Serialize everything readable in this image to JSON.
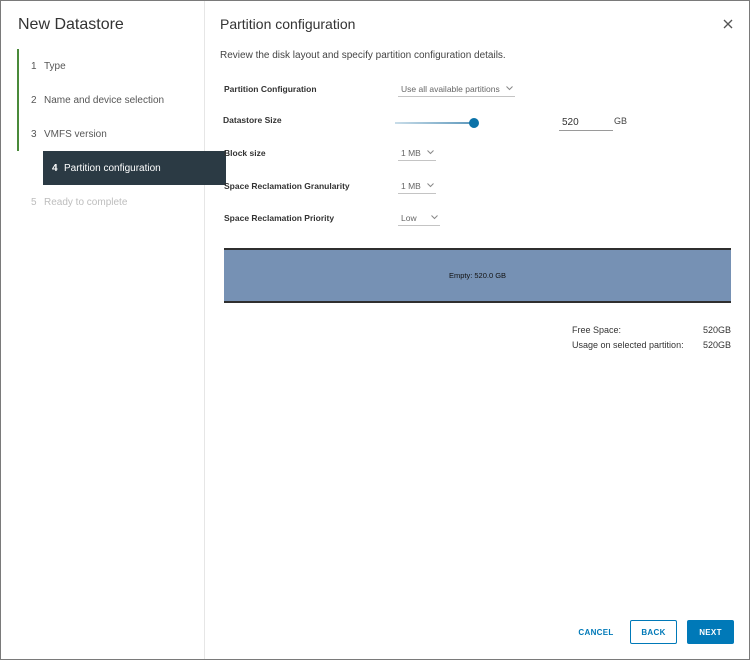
{
  "sidebar": {
    "title": "New Datastore",
    "steps": [
      {
        "num": "1",
        "label": "Type"
      },
      {
        "num": "2",
        "label": "Name and device selection"
      },
      {
        "num": "3",
        "label": "VMFS version"
      },
      {
        "num": "4",
        "label": "Partition configuration"
      },
      {
        "num": "5",
        "label": "Ready to complete"
      }
    ]
  },
  "main": {
    "title": "Partition configuration",
    "subtitle": "Review the disk layout and specify partition configuration details."
  },
  "form": {
    "partition_config_label": "Partition Configuration",
    "partition_config_value": "Use all available partitions",
    "datastore_size_label": "Datastore Size",
    "datastore_size_value": "520",
    "datastore_size_unit": "GB",
    "datastore_size_slider_fraction": 1.0,
    "block_size_label": "Block size",
    "block_size_value": "1 MB",
    "granularity_label": "Space Reclamation Granularity",
    "granularity_value": "1 MB",
    "priority_label": "Space Reclamation Priority",
    "priority_value": "Low"
  },
  "disk": {
    "label": "Empty: 520.0 GB",
    "color": "#7691b4"
  },
  "summary": {
    "free_space_label": "Free Space:",
    "free_space_value": "520GB",
    "usage_label": "Usage on selected partition:",
    "usage_value": "520GB"
  },
  "buttons": {
    "cancel": "CANCEL",
    "back": "BACK",
    "next": "NEXT"
  },
  "colors": {
    "accent": "#0079b8",
    "completed_step": "#4a8a3a",
    "active_step_bg": "#2b3a44"
  },
  "icons": {
    "close": "close-icon",
    "chevron": "chevron-down-icon"
  }
}
